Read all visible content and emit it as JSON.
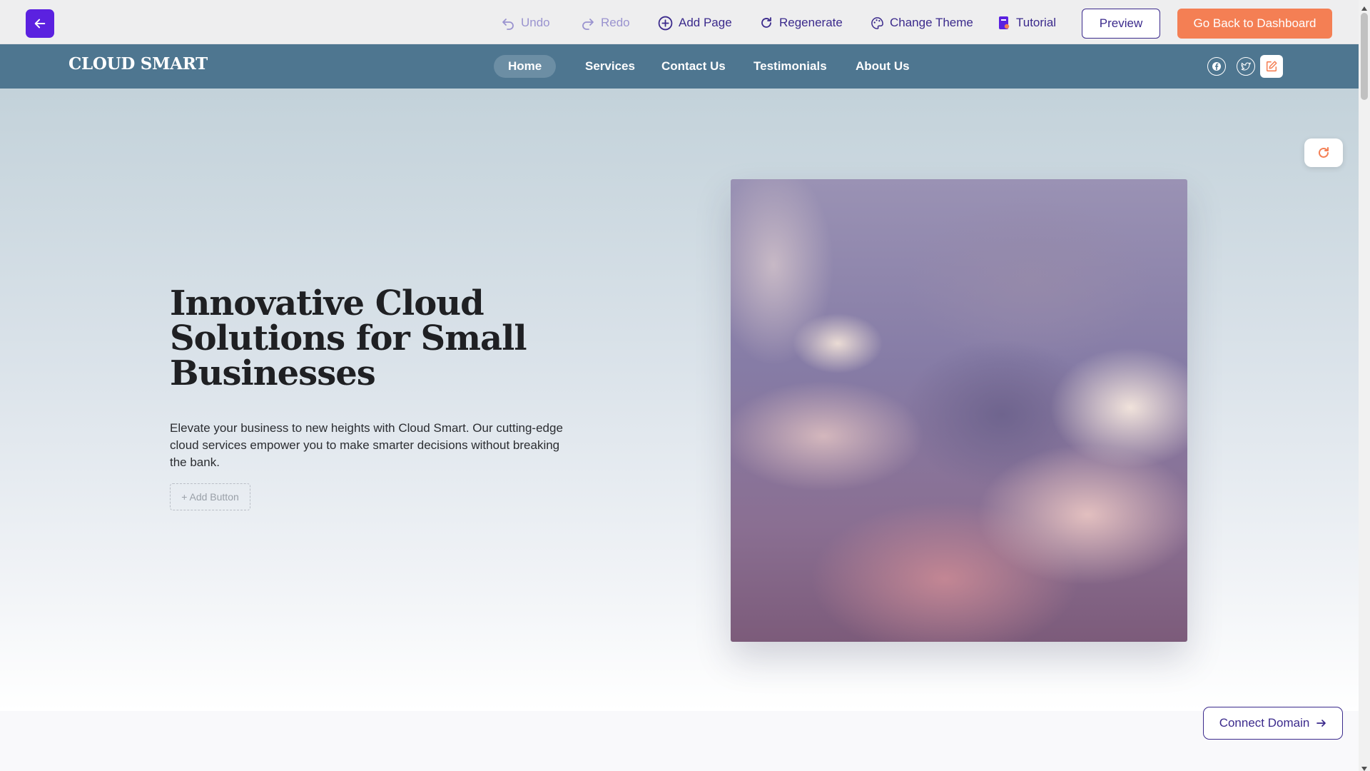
{
  "editor_toolbar": {
    "undo": "Undo",
    "redo": "Redo",
    "add_page": "Add Page",
    "regenerate": "Regenerate",
    "change_theme": "Change Theme",
    "tutorial": "Tutorial",
    "preview": "Preview",
    "dashboard": "Go Back to Dashboard"
  },
  "site": {
    "logo": "CLOUD SMART",
    "nav": [
      "Home",
      "Services",
      "Contact Us",
      "Testimonials",
      "About Us"
    ],
    "active_nav": "Home"
  },
  "hero": {
    "title": "Innovative Cloud Solutions for Small Businesses",
    "description": "Elevate your business to new heights with Cloud Smart. Our cutting-edge cloud services empower you to make smarter decisions without breaking the bank.",
    "add_button": "+ Add Button"
  },
  "connect_domain": "Connect Domain",
  "colors": {
    "accent": "#5b21e0",
    "primary_text": "#3b2a8c",
    "cta": "#f47f54",
    "site_nav": "#4e7690"
  },
  "icons": {
    "back": "arrow-left-icon",
    "undo": "undo-icon",
    "redo": "redo-icon",
    "add_page": "plus-circle-icon",
    "regenerate": "refresh-icon",
    "theme": "palette-icon",
    "tutorial": "book-icon",
    "facebook": "facebook-icon",
    "twitter": "twitter-icon",
    "edit": "edit-icon",
    "arrow": "arrow-right-icon"
  }
}
